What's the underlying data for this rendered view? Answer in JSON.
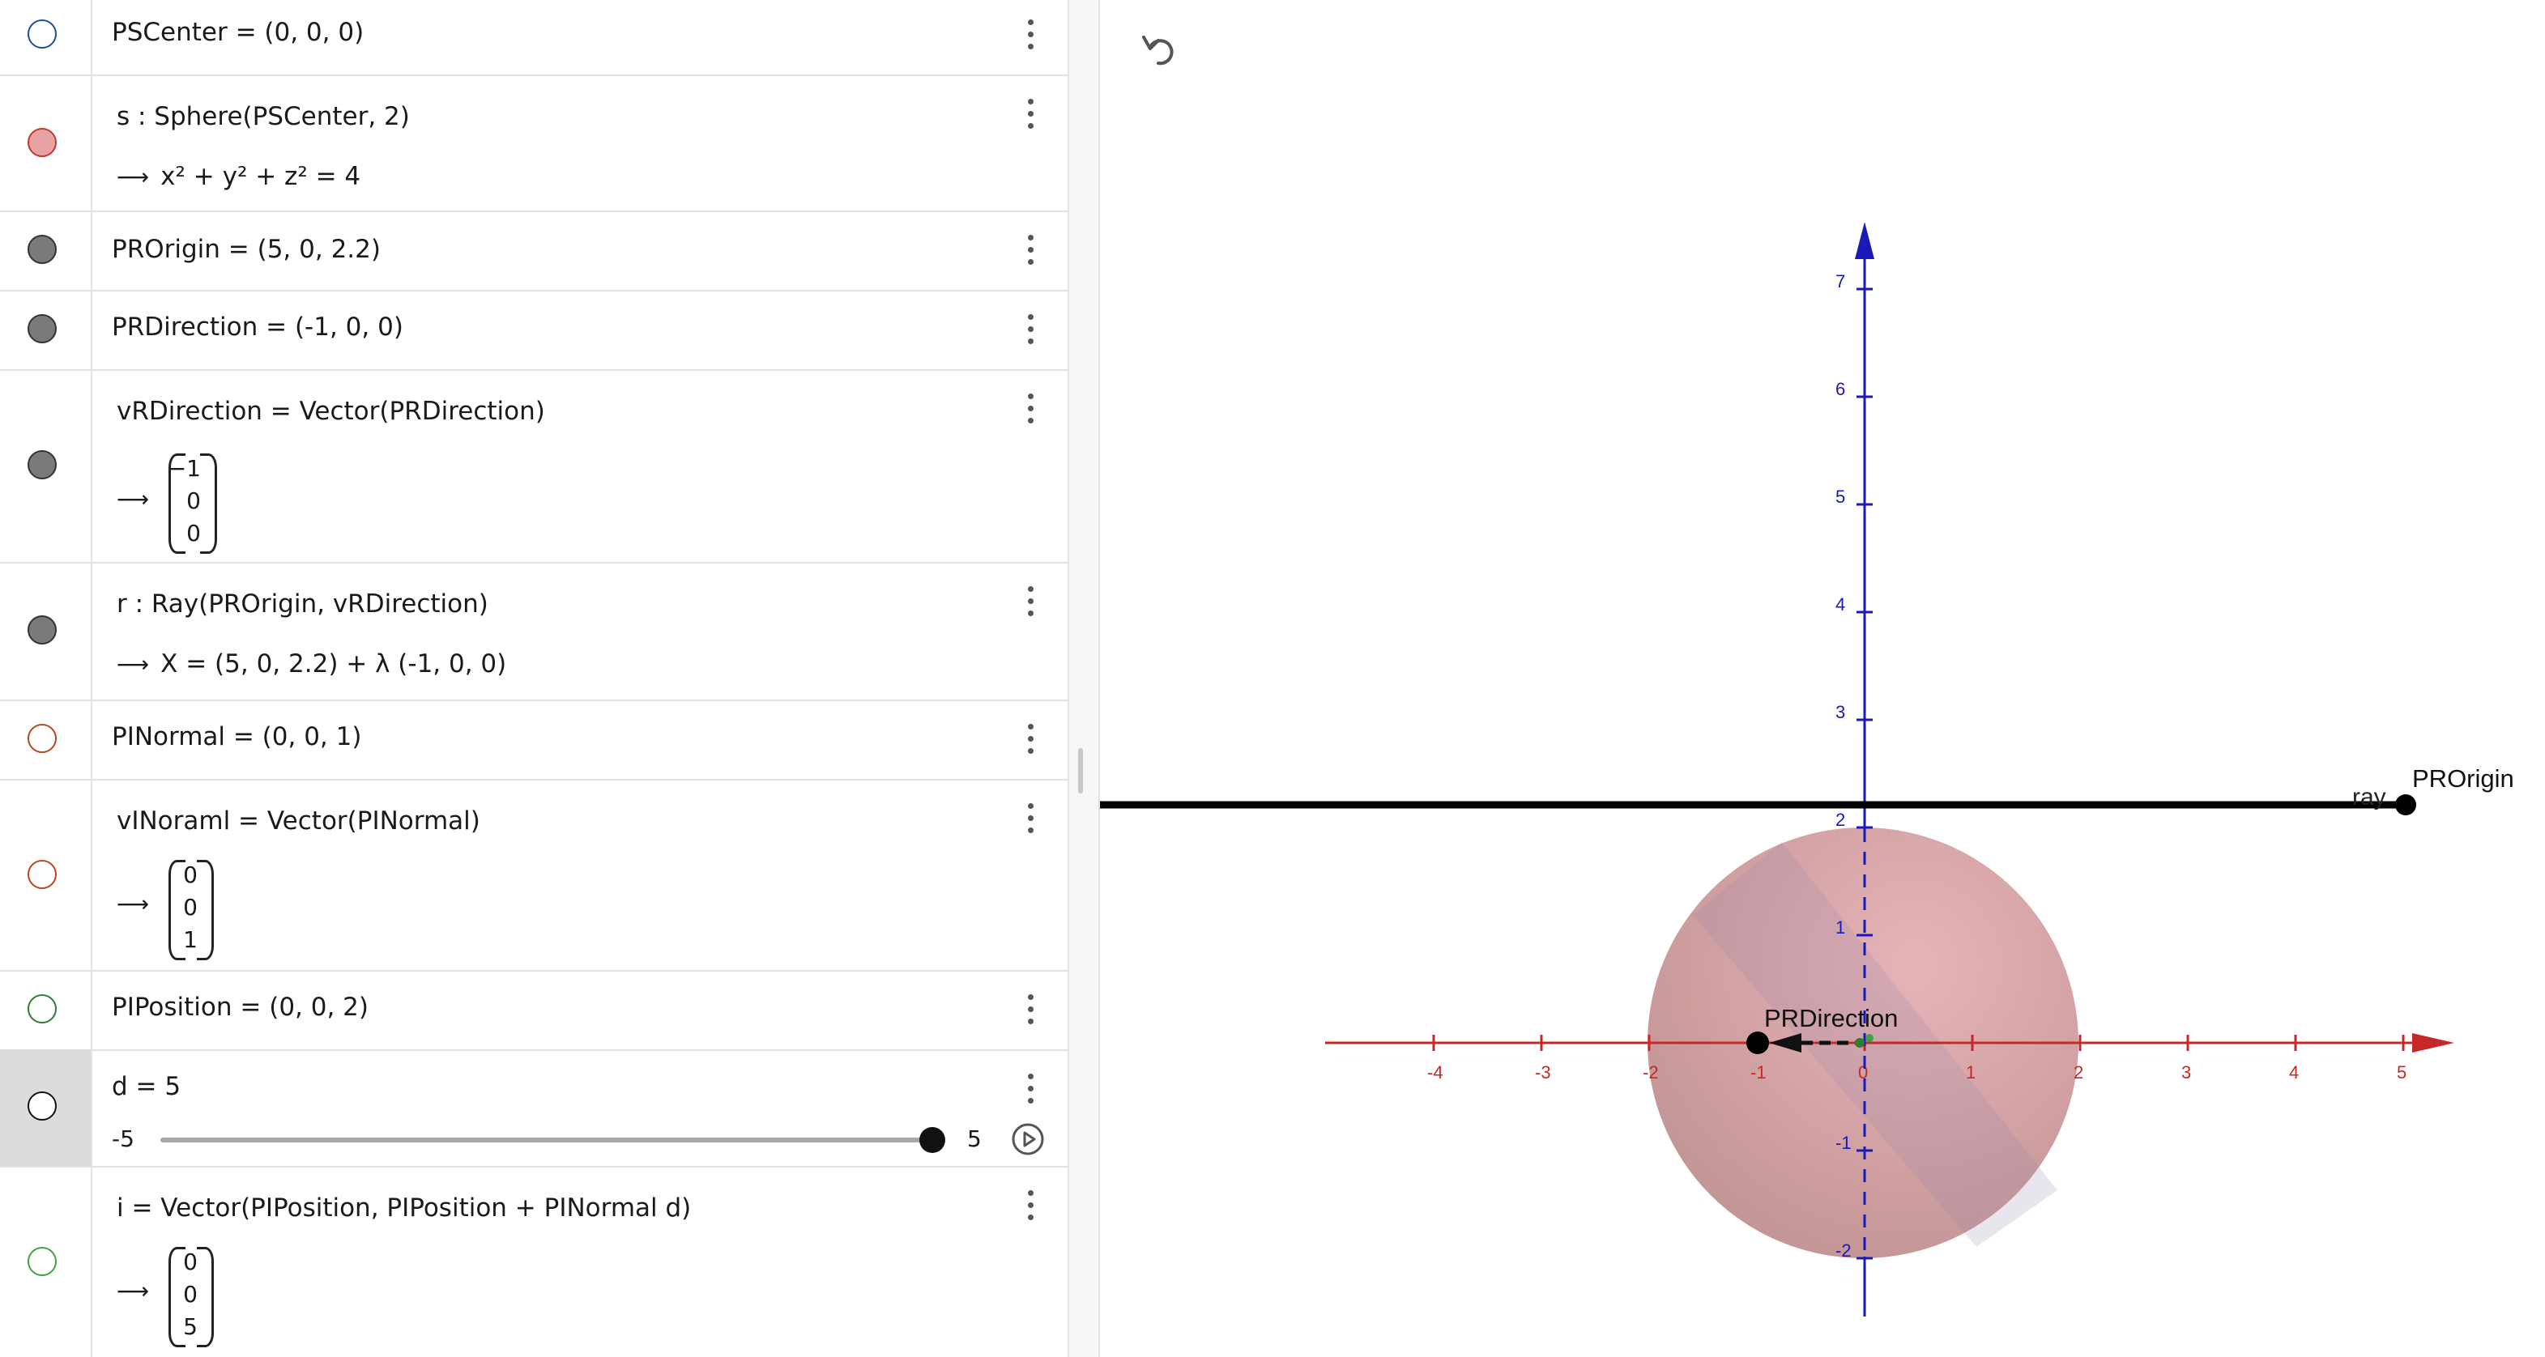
{
  "algebra": {
    "rows": [
      {
        "input": "PSCenter = (0, 0, 0)",
        "marble": "hollow",
        "color": "#1f4e9c"
      },
      {
        "input": "s : Sphere(PSCenter, 2)",
        "output": "x² + y² + z² = 4",
        "marble": "filled",
        "color": "#e8a4a4"
      },
      {
        "input": "PROrigin = (5, 0, 2.2)",
        "marble": "filled",
        "color": "#7a7a7a"
      },
      {
        "input": "PRDirection = (-1, 0, 0)",
        "marble": "filled",
        "color": "#7a7a7a"
      },
      {
        "input": "vRDirection = Vector(PRDirection)",
        "vector": [
          "−1",
          "0",
          "0"
        ],
        "marble": "filled",
        "color": "#7a7a7a"
      },
      {
        "input": "r : Ray(PROrigin, vRDirection)",
        "output": "X = (5, 0, 2.2) + λ (-1, 0, 0)",
        "marble": "filled",
        "color": "#7a7a7a"
      },
      {
        "input": "PINormal = (0, 0, 1)",
        "marble": "hollow",
        "color": "#b5471f"
      },
      {
        "input": "vINoraml = Vector(PINormal)",
        "vector": [
          "0",
          "0",
          "1"
        ],
        "marble": "hollow",
        "color": "#b5471f"
      },
      {
        "input": "PIPosition = (0, 0, 2)",
        "marble": "hollow",
        "color": "#2e7d32"
      },
      {
        "input": "d = 5",
        "slider": {
          "min": "-5",
          "max": "5",
          "value": 5
        },
        "marble": "hollow",
        "color": "#111111"
      },
      {
        "input": "i = Vector(PIPosition, PIPosition + PINormal d)",
        "vector": [
          "0",
          "0",
          "5"
        ],
        "marble": "hollow",
        "color": "#43a047"
      }
    ]
  },
  "graphics": {
    "x_ticks": [
      "-4",
      "-3",
      "-2",
      "-1",
      "0",
      "1",
      "2",
      "3",
      "4",
      "5"
    ],
    "z_ticks": [
      "-2",
      "-1",
      "1",
      "2",
      "3",
      "4",
      "5",
      "6",
      "7"
    ],
    "x_axis_color": "#c62828",
    "z_axis_color": "#1a1ab8",
    "sphere_color": "#e8a4a4",
    "labels": {
      "ray": "ray",
      "pr_origin": "PROrigin",
      "pr_direction": "PRDirection"
    }
  }
}
